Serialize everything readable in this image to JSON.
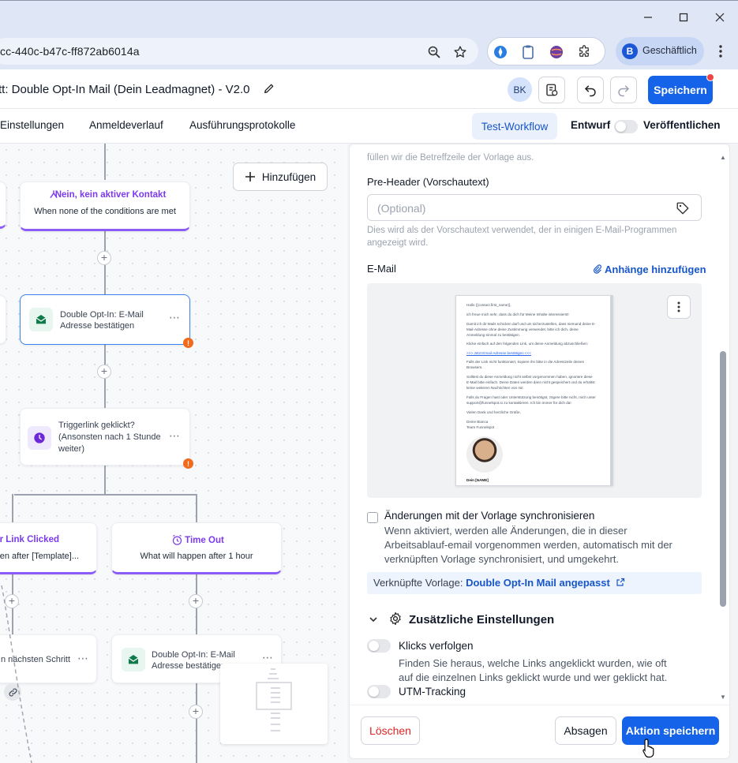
{
  "browser": {
    "url": "cc-440c-b47c-ff872ab6014a",
    "profile_initial": "B",
    "profile_name": "Geschäftlich"
  },
  "header": {
    "title": "tt: Double Opt-In Mail (Dein Leadmagnet) - V2.0",
    "user_initials": "BK",
    "save_label": "Speichern"
  },
  "tabs": {
    "items": [
      "Einstellungen",
      "Anmeldeverlauf",
      "Ausführungsprotokolle"
    ],
    "test_workflow": "Test-Workflow",
    "draft": "Entwurf",
    "publish": "Veröffentlichen"
  },
  "canvas": {
    "add_label": "Hinzufügen",
    "branch_none": {
      "title": "Nein, kein aktiver Kontakt",
      "sub": "When none of the conditions are met"
    },
    "email_node": {
      "line1": "Double Opt-In: E-Mail",
      "line2": "Adresse bestätigen"
    },
    "wait_node": {
      "line1": "Triggerlink geklickt?",
      "line2": "(Ansonsten nach 1 Stunde",
      "line3": "weiter)"
    },
    "branch_clicked": {
      "title": "ger Link Clicked",
      "sub": "pen after [Template]..."
    },
    "branch_timeout": {
      "title": "Time Out",
      "sub": "What will happen after 1 hour"
    },
    "next_step_node": {
      "text": "n nächsten Schritt"
    },
    "email_node_2": {
      "line1": "Double Opt-In: E-Mail",
      "line2": "Adresse bestätigen"
    }
  },
  "panel": {
    "subject_hint_tail": "füllen wir die Betreffzeile der Vorlage aus.",
    "preheader_label": "Pre-Header (Vorschautext)",
    "preheader_placeholder": "(Optional)",
    "preheader_hint_1": "Dies wird als der Vorschautext verwendet, der in einigen E-Mail-Programmen",
    "preheader_hint_2": "angezeigt wird.",
    "email_label": "E-Mail",
    "attachments_label": "Anhänge hinzufügen",
    "email_preview": {
      "lines": [
        "Hallo {{contact.first_name}},",
        "ich freue mich sehr, dass du dich für Meine Inhalte interessierst!",
        "Damit ich dir Mails schicken darf und um sicherzustellen, dass niemand deine E-",
        "Mail-Adresse ohne deine Zustimmung verwendet, bitte ich dich, deine",
        "Anmeldung einmal zu bestätigen.",
        "Klicke einfach auf den folgenden Link, um deine Anmeldung abzuschließen:",
        ">>> Jetzt Email-Adresse bestätigen <<<",
        "Falls der Link nicht funktioniert, kopiere ihn bitte in die Adresszeile deines",
        "Browsers.",
        "Solltest du diese Anmeldung nicht selbst vorgenommen haben, ignoriere diese",
        "E-Mail bitte einfach. Deine Daten werden dann nicht gespeichert und du erhältst",
        "keine weiteren Nachrichten von mir.",
        "Falls du Fragen hast oder Unterstützung benötigst, zögere bitte nicht, mich unter",
        "support@funnelspot.io zu kontaktieren. Ich bin immer für dich da!",
        "Vielen Dank und herzliche Grüße,",
        "Deine Bianca",
        "Team Funnelspot",
        "Dein [NAME]"
      ]
    },
    "sync_title": "Änderungen mit der Vorlage synchronisieren",
    "sync_desc": "Wenn aktiviert, werden alle Änderungen, die in dieser Arbeitsablauf-email vorgenommen werden, automatisch mit der verknüpften Vorlage synchronisiert, und umgekehrt.",
    "linked_prefix": "Verknüpfte Vorlage: ",
    "linked_name": "Double Opt-In Mail angepasst",
    "additional_settings": "Zusätzliche Einstellungen",
    "track_clicks_label": "Klicks verfolgen",
    "track_clicks_desc_1": "Finden Sie heraus, welche Links angeklickt wurden, wie oft",
    "track_clicks_desc_2": "auf die einzelnen Links geklickt wurde und wer geklickt hat.",
    "utm_label": "UTM-Tracking",
    "delete_label": "Löschen",
    "cancel_label": "Absagen",
    "save_action_label": "Aktion speichern"
  },
  "colors": {
    "primary": "#1563e8",
    "branch_purple": "#7c3aed",
    "warning": "#f26a1b",
    "danger": "#dc2626"
  }
}
